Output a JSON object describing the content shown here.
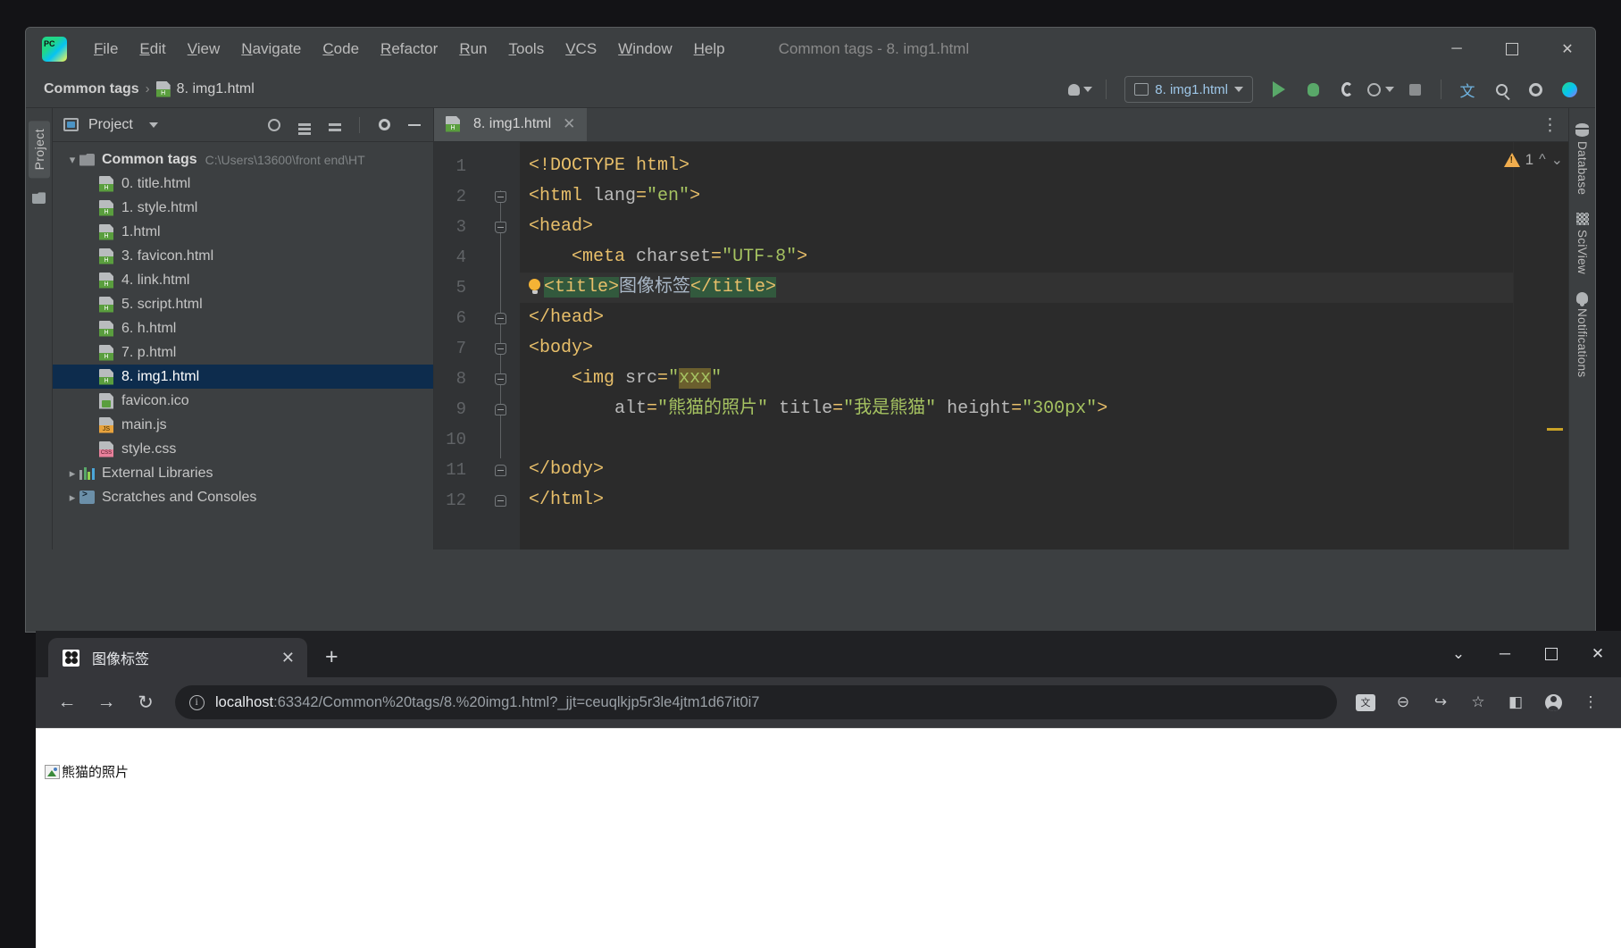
{
  "ide": {
    "window_title": "Common tags - 8. img1.html",
    "logo_text": "PC",
    "menu": [
      {
        "label": "File",
        "mnemonic": "F"
      },
      {
        "label": "Edit",
        "mnemonic": "E"
      },
      {
        "label": "View",
        "mnemonic": "V"
      },
      {
        "label": "Navigate",
        "mnemonic": "N"
      },
      {
        "label": "Code",
        "mnemonic": "C"
      },
      {
        "label": "Refactor",
        "mnemonic": "R"
      },
      {
        "label": "Run",
        "mnemonic": "R"
      },
      {
        "label": "Tools",
        "mnemonic": "T"
      },
      {
        "label": "VCS",
        "mnemonic": "V"
      },
      {
        "label": "Window",
        "mnemonic": "W"
      },
      {
        "label": "Help",
        "mnemonic": "H"
      }
    ],
    "window_controls": {
      "minimize": "─",
      "maximize": "☐",
      "close": "✕"
    },
    "breadcrumb": {
      "project": "Common tags",
      "separator": "›",
      "file": "8. img1.html"
    },
    "toolbar": {
      "run_config": "8. img1.html",
      "run_label": "Run",
      "debug_label": "Debug",
      "coverage_label": "Run with Coverage",
      "profile_label": "Profile",
      "stop_label": "Stop",
      "translate_label": "Translate",
      "search_label": "Search Everywhere",
      "settings_label": "Settings",
      "updates_label": "Updates"
    },
    "left_strip_label": "Project",
    "project_panel": {
      "title": "Project",
      "tree": [
        {
          "label": "Common tags",
          "path": "C:\\Users\\13600\\front end\\HT",
          "type": "folder",
          "expanded": true,
          "bold": true,
          "indent": 0
        },
        {
          "label": "0. title.html",
          "type": "html",
          "indent": 1
        },
        {
          "label": "1. style.html",
          "type": "html",
          "indent": 1
        },
        {
          "label": "1.html",
          "type": "html",
          "indent": 1
        },
        {
          "label": "3. favicon.html",
          "type": "html",
          "indent": 1
        },
        {
          "label": "4. link.html",
          "type": "html",
          "indent": 1
        },
        {
          "label": "5. script.html",
          "type": "html",
          "indent": 1
        },
        {
          "label": "6. h.html",
          "type": "html",
          "indent": 1
        },
        {
          "label": "7. p.html",
          "type": "html",
          "indent": 1
        },
        {
          "label": "8. img1.html",
          "type": "html",
          "indent": 1,
          "selected": true
        },
        {
          "label": "favicon.ico",
          "type": "ico",
          "indent": 1
        },
        {
          "label": "main.js",
          "type": "js",
          "indent": 1
        },
        {
          "label": "style.css",
          "type": "css",
          "indent": 1
        },
        {
          "label": "External Libraries",
          "type": "libs",
          "expanded": false,
          "indent": 0
        },
        {
          "label": "Scratches and Consoles",
          "type": "scratch",
          "expanded": false,
          "indent": 0
        }
      ]
    },
    "editor": {
      "tab_label": "8. img1.html",
      "tab_close": "✕",
      "warning_count": "1",
      "lines": [
        {
          "n": "1",
          "fold": "",
          "html": "<span class=\"tag\">&lt;!DOCTYPE html&gt;</span>"
        },
        {
          "n": "2",
          "fold": "top",
          "html": "<span class=\"tag\">&lt;html </span><span class=\"attr\">lang</span><span class=\"tag\">=</span><span class=\"str\">\"en\"</span><span class=\"tag\">&gt;</span>"
        },
        {
          "n": "3",
          "fold": "top",
          "html": "<span class=\"tag\">&lt;head&gt;</span>"
        },
        {
          "n": "4",
          "fold": "",
          "html": "    <span class=\"tag\">&lt;meta </span><span class=\"attr\">charset</span><span class=\"tag\">=</span><span class=\"str\">\"UTF-8\"</span><span class=\"tag\">&gt;</span>"
        },
        {
          "n": "5",
          "fold": "",
          "hi": true,
          "bulb": true,
          "html": "<span class=\"sel-bg tag\">&lt;title&gt;</span><span class=\"txt\">图像标签</span><span class=\"sel-bg tag\">&lt;/title&gt;</span>"
        },
        {
          "n": "6",
          "fold": "bot",
          "html": "<span class=\"tag\">&lt;/head&gt;</span>"
        },
        {
          "n": "7",
          "fold": "top",
          "html": "<span class=\"tag\">&lt;body&gt;</span>"
        },
        {
          "n": "8",
          "fold": "top",
          "html": "    <span class=\"tag\">&lt;img </span><span class=\"attr\">src</span><span class=\"tag\">=</span><span class=\"str\">\"</span><span class=\"str err-bg\">xxx</span><span class=\"str\">\"</span>"
        },
        {
          "n": "9",
          "fold": "bot",
          "html": "        <span class=\"attr\">alt</span><span class=\"tag\">=</span><span class=\"str\">\"熊猫的照片\"</span> <span class=\"attr\">title</span><span class=\"tag\">=</span><span class=\"str\">\"我是熊猫\"</span> <span class=\"attr\">height</span><span class=\"tag\">=</span><span class=\"str\">\"300px\"</span><span class=\"tag\">&gt;</span>"
        },
        {
          "n": "10",
          "fold": "",
          "html": ""
        },
        {
          "n": "11",
          "fold": "bot",
          "html": "<span class=\"tag\">&lt;/body&gt;</span>"
        },
        {
          "n": "12",
          "fold": "bot",
          "html": "<span class=\"tag\">&lt;/html&gt;</span>"
        }
      ]
    },
    "right_strip": [
      {
        "label": "Database",
        "icon": "database-icon"
      },
      {
        "label": "SciView",
        "icon": "grid-icon"
      },
      {
        "label": "Notifications",
        "icon": "bell-icon"
      }
    ]
  },
  "browser": {
    "tab_title": "图像标签",
    "tab_close": "✕",
    "new_tab": "+",
    "window_controls": {
      "minimize": "─",
      "maximize": "☐",
      "close": "✕",
      "collapse": "⌄"
    },
    "nav": {
      "back": "←",
      "forward": "→",
      "reload": "↻"
    },
    "url_host": "localhost",
    "url_rest": ":63342/Common%20tags/8.%20img1.html?_jjt=ceuqlkjp5r3le4jtm1d67it0i7",
    "actions": {
      "translate": "文",
      "zoom": "⊖",
      "share": "↪",
      "bookmark": "☆",
      "sidepanel": "◧",
      "profile": "profile",
      "menu": "⋮"
    },
    "page": {
      "alt_text": "熊猫的照片"
    }
  },
  "colors": {
    "ide_chrome": "#3c3f41",
    "editor_bg": "#2b2b2b",
    "gutter_bg": "#313335",
    "selection": "#0d2c4d",
    "tag": "#e8bf6a",
    "string": "#a5c261",
    "attr": "#bababa",
    "warning": "#f0ad4e",
    "run_green": "#59a869",
    "browser_chrome": "#35363a",
    "browser_dark": "#202124"
  }
}
